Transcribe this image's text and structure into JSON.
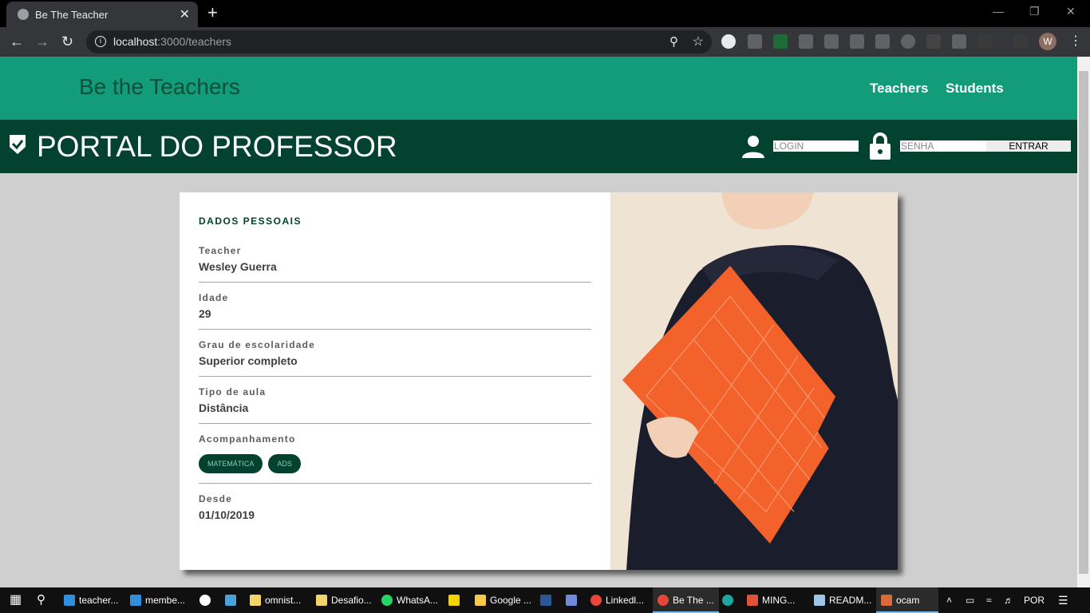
{
  "browser": {
    "tab_title": "Be The Teacher",
    "tab_close": "✕",
    "new_tab": "+",
    "url_host": "localhost",
    "url_path": ":3000/teachers",
    "profile_initial": "W"
  },
  "site": {
    "brand": "Be the Teachers",
    "nav": [
      "Teachers",
      "Students"
    ]
  },
  "portal": {
    "title": "PORTAL DO PROFESSOR",
    "login_placeholder": "LOGIN",
    "password_placeholder": "SENHA",
    "submit_label": "ENTRAR"
  },
  "profile": {
    "section_title": "DADOS PESSOAIS",
    "fields": [
      {
        "label": "Teacher",
        "value": "Wesley Guerra"
      },
      {
        "label": "Idade",
        "value": "29"
      },
      {
        "label": "Grau de escolaridade",
        "value": "Superior completo"
      },
      {
        "label": "Tipo de aula",
        "value": "Distância"
      }
    ],
    "tracking_label": "Acompanhamento",
    "tracking_chips": [
      "MATEMÁTICA",
      "ADS"
    ],
    "since_label": "Desde",
    "since_value": "01/10/2019"
  },
  "taskbar": {
    "items": [
      "teacher...",
      "membe...",
      "omnist...",
      "Desafio...",
      "WhatsA...",
      "Google ...",
      "Linkedl...",
      "Be The ...",
      "MING...",
      "READM...",
      "ocam"
    ],
    "language": "POR"
  },
  "colors": {
    "header_green": "#139c79",
    "portal_dark_green": "#03422f",
    "page_bg": "#cfcfcf"
  }
}
